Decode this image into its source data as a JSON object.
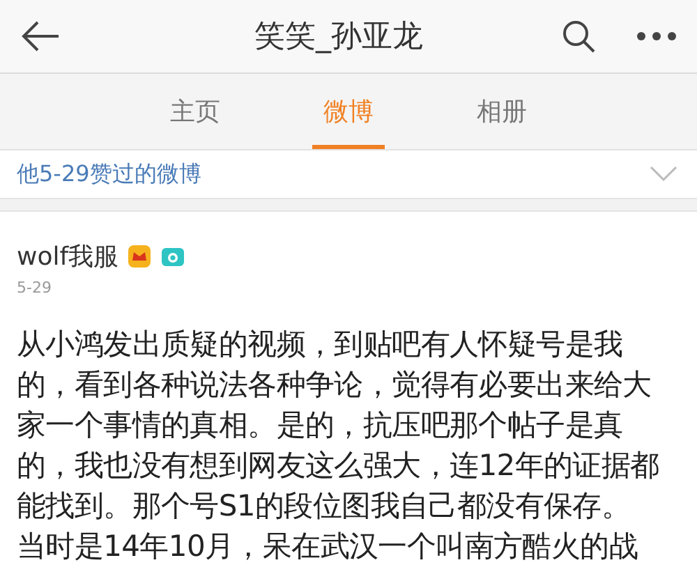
{
  "header": {
    "title": "笑笑_孙亚龙"
  },
  "tabs": [
    {
      "label": "主页",
      "selected": false
    },
    {
      "label": "微博",
      "selected": true
    },
    {
      "label": "相册",
      "selected": false
    }
  ],
  "filter": {
    "label": "他5-29赞过的微博"
  },
  "post": {
    "author": "wolf我服",
    "date": "5-29",
    "lines": [
      "从小鸿发出质疑的视频，到贴吧有人怀疑号是我",
      "的，看到各种说法各种争论，觉得有必要出来给大",
      "家一个事情的真相。是的，抗压吧那个帖子是真",
      "的，我也没有想到网友这么强大，连12年的证据都",
      "能找到。那个号S1的段位图我自己都没有保存。",
      "当时是14年10月，呆在武汉一个叫南方酷火的战"
    ]
  }
}
